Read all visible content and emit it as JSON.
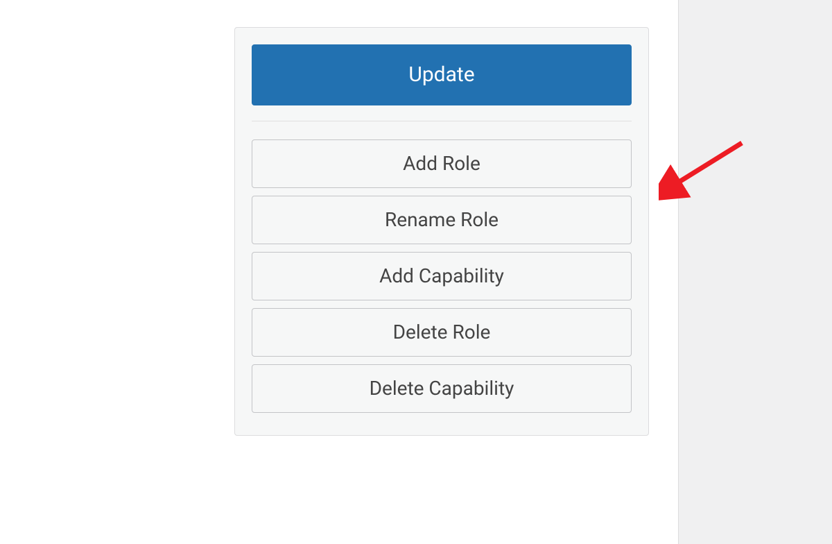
{
  "panel": {
    "update_label": "Update",
    "actions": [
      {
        "label": "Add Role",
        "name": "add-role-button"
      },
      {
        "label": "Rename Role",
        "name": "rename-role-button"
      },
      {
        "label": "Add Capability",
        "name": "add-capability-button"
      },
      {
        "label": "Delete Role",
        "name": "delete-role-button"
      },
      {
        "label": "Delete Capability",
        "name": "delete-capability-button"
      }
    ]
  },
  "annotation": {
    "arrow_color": "#ed1c24"
  }
}
